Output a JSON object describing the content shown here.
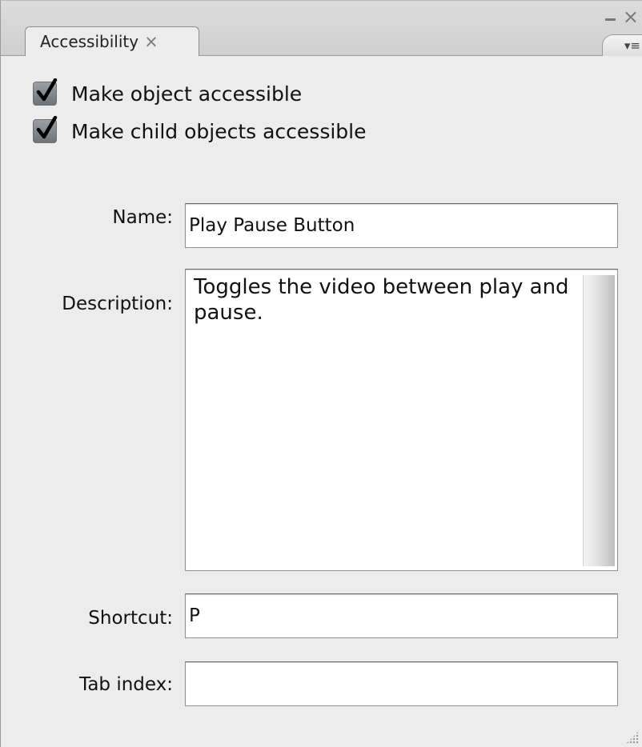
{
  "panel": {
    "tab_label": "Accessibility",
    "tab_close_glyph": "×",
    "minimize_glyph": "–",
    "close_glyph": "×",
    "menu_glyph": "▾≡"
  },
  "options": {
    "make_object_accessible": {
      "label": "Make object accessible",
      "checked": true
    },
    "make_child_objects_accessible": {
      "label": "Make child objects accessible",
      "checked": true
    }
  },
  "fields": {
    "name": {
      "label": "Name:",
      "value": "Play Pause Button"
    },
    "description": {
      "label": "Description:",
      "value": "Toggles the video between play and pause."
    },
    "shortcut": {
      "label": "Shortcut:",
      "value": "P"
    },
    "tab_index": {
      "label": "Tab index:",
      "value": ""
    }
  },
  "colors": {
    "panel_bg": "#ececec",
    "checkbox_fill": "#7e848b"
  }
}
